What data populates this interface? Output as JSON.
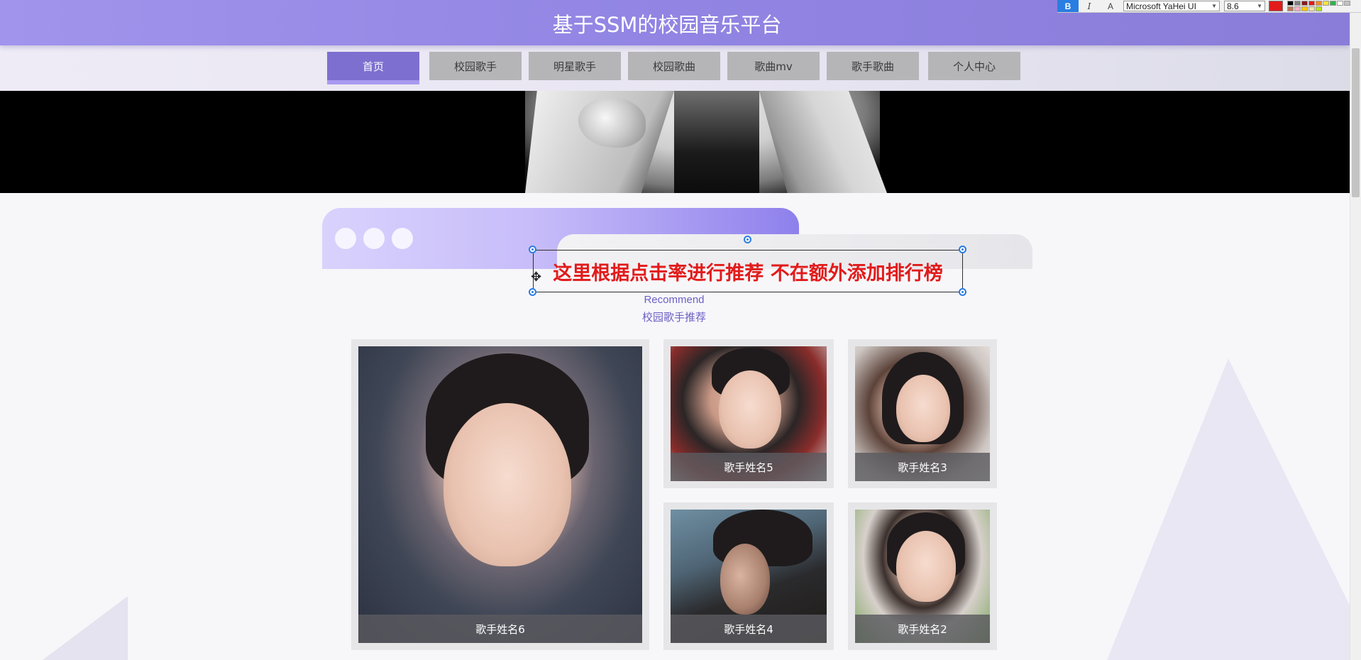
{
  "site": {
    "title": "基于SSM的校园音乐平台"
  },
  "nav": {
    "items": [
      {
        "label": "首页",
        "active": true
      },
      {
        "label": "校园歌手",
        "active": false
      },
      {
        "label": "明星歌手",
        "active": false
      },
      {
        "label": "校园歌曲",
        "active": false
      },
      {
        "label": "歌曲mv",
        "active": false
      },
      {
        "label": "歌手歌曲",
        "active": false
      },
      {
        "label": "个人中心",
        "active": false
      }
    ]
  },
  "editor_toolbar": {
    "bold_label": "B",
    "italic_label": "I",
    "format_label": "A",
    "font_name": "Microsoft YaHei UI",
    "font_size": "8.6",
    "active_color": "#e21b1b"
  },
  "annotation": {
    "text": "这里根据点击率进行推荐 不在额外添加排行榜",
    "color": "#e21b1b"
  },
  "section": {
    "en_title": "Recommend",
    "cn_title": "校园歌手推荐"
  },
  "singers": [
    {
      "name": "歌手姓名6"
    },
    {
      "name": "歌手姓名5"
    },
    {
      "name": "歌手姓名3"
    },
    {
      "name": "歌手姓名4"
    },
    {
      "name": "歌手姓名2"
    }
  ],
  "colors": {
    "header": "#9184e3",
    "nav_active": "#7d6fd0",
    "nav_inactive": "#b5b5b8",
    "accent_text": "#6b5fc4"
  }
}
